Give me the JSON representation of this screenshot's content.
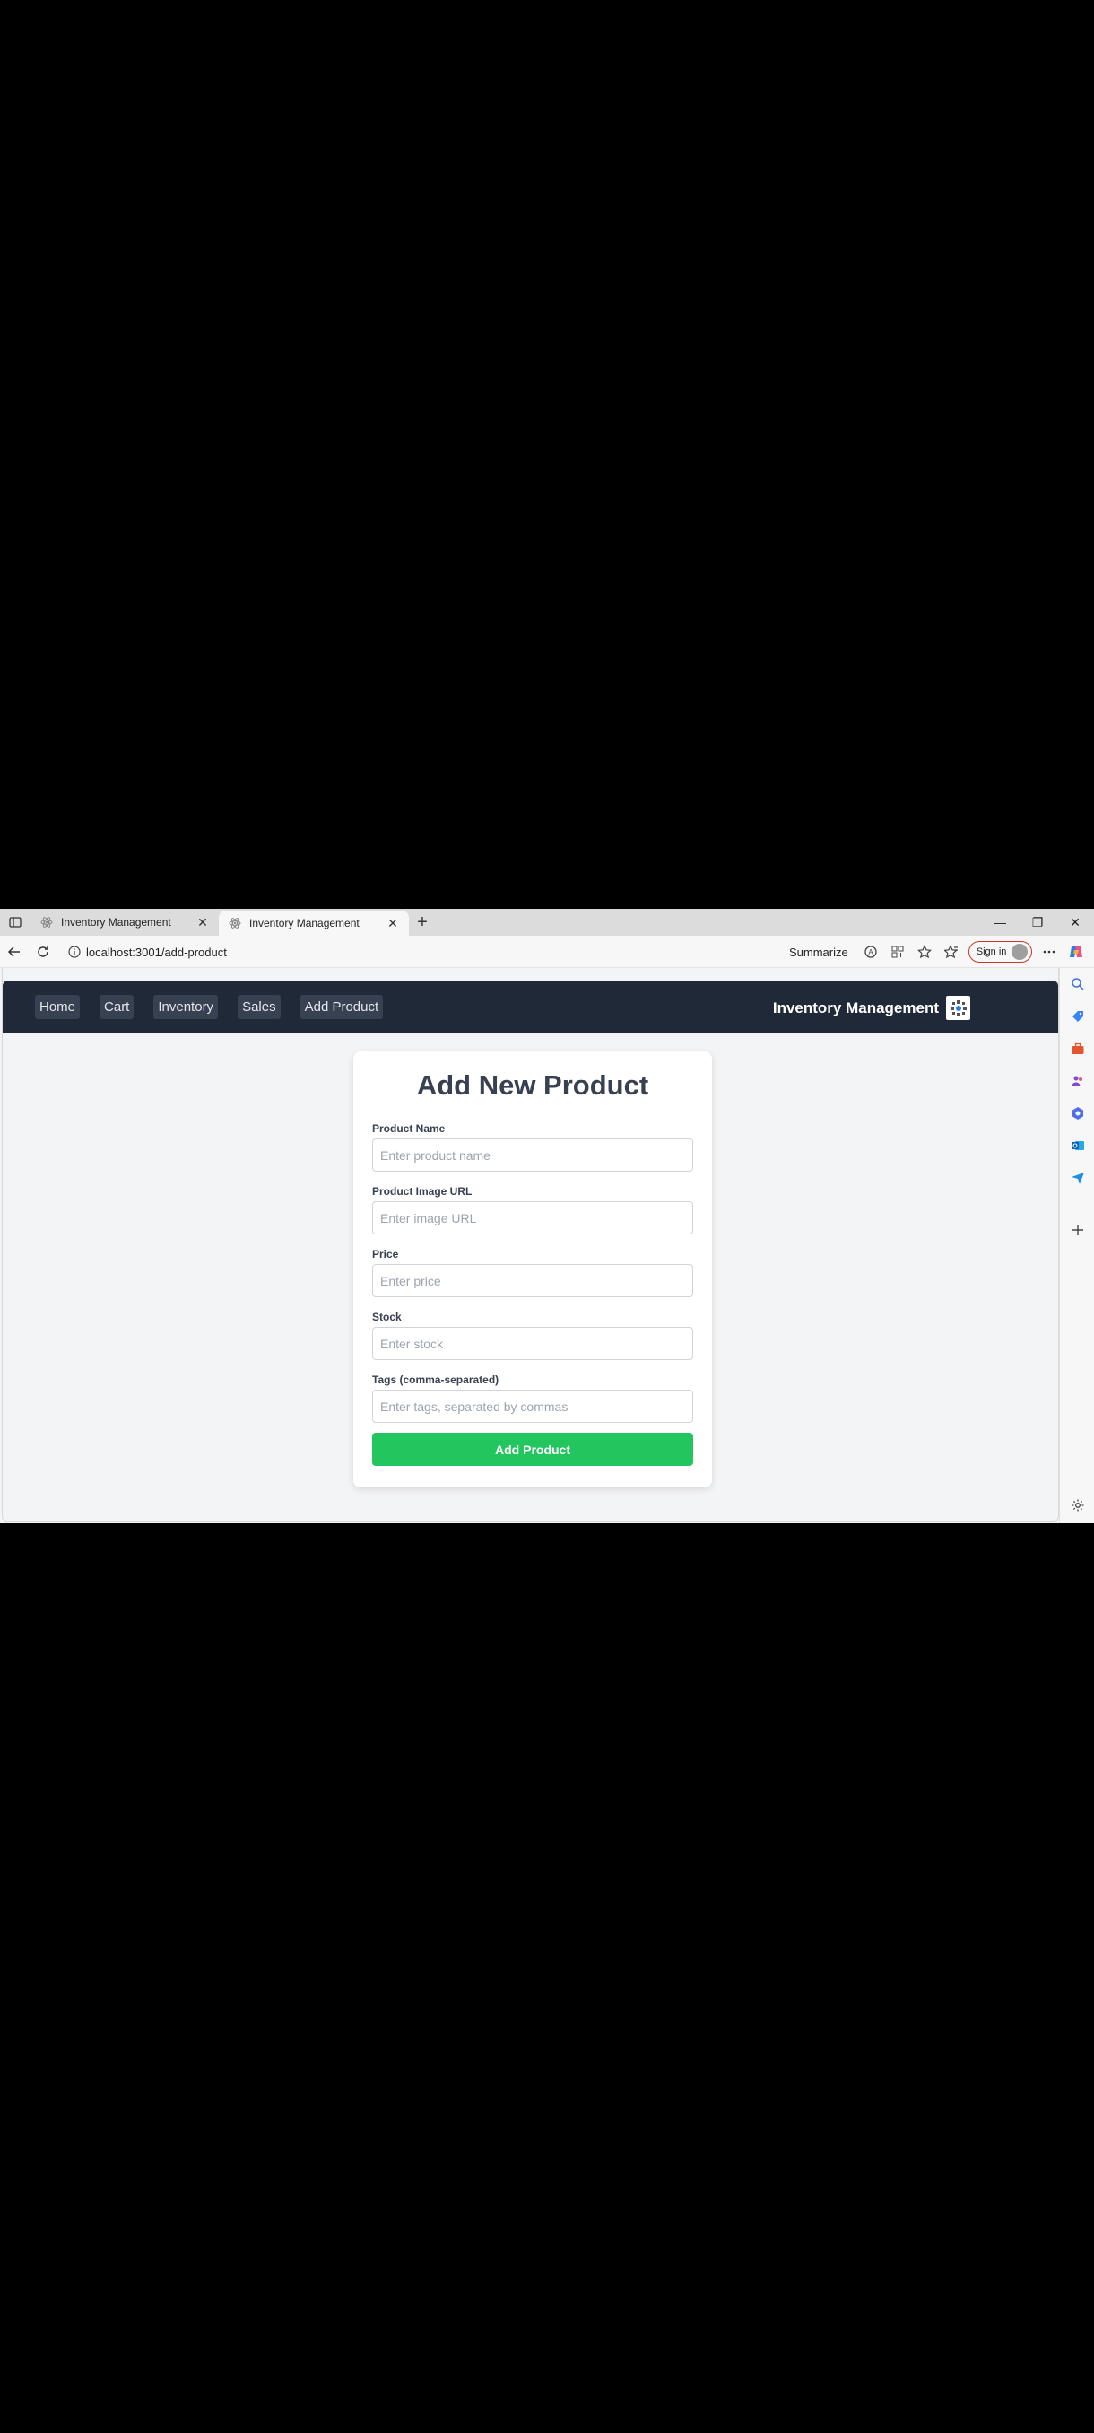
{
  "browser": {
    "tabs": [
      {
        "title": "Inventory Management",
        "active": false
      },
      {
        "title": "Inventory Management",
        "active": true
      }
    ],
    "url": "localhost:3001/add-product",
    "summarize_label": "Summarize",
    "signin_label": "Sign in",
    "window_controls": [
      "minimize",
      "restore",
      "close"
    ]
  },
  "nav": {
    "links": [
      "Home",
      "Cart",
      "Inventory",
      "Sales",
      "Add Product"
    ],
    "brand": "Inventory Management"
  },
  "form": {
    "title": "Add New Product",
    "fields": [
      {
        "label": "Product Name",
        "placeholder": "Enter product name",
        "value": ""
      },
      {
        "label": "Product Image URL",
        "placeholder": "Enter image URL",
        "value": ""
      },
      {
        "label": "Price",
        "placeholder": "Enter price",
        "value": ""
      },
      {
        "label": "Stock",
        "placeholder": "Enter stock",
        "value": ""
      },
      {
        "label": "Tags (comma-separated)",
        "placeholder": "Enter tags, separated by commas",
        "value": ""
      }
    ],
    "submit_label": "Add Product"
  },
  "colors": {
    "nav_bg": "#1f2937",
    "nav_link_bg": "#374151",
    "submit_bg": "#22c55e",
    "page_bg": "#f3f4f6"
  },
  "sidebar_icons": [
    "search-icon",
    "tag-icon",
    "toolbox-icon",
    "people-icon",
    "copilot-icon",
    "outlook-icon",
    "send-icon",
    "add-icon",
    "settings-icon"
  ]
}
